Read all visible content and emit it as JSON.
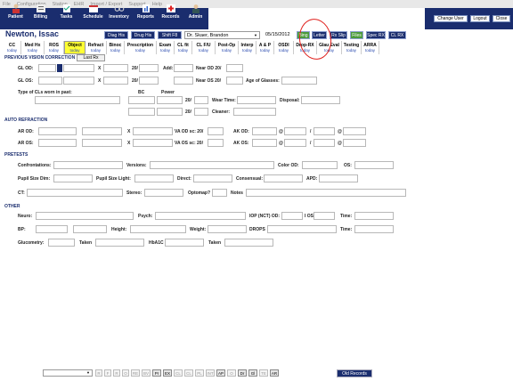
{
  "menu": [
    "File",
    "Configuration",
    "Station",
    "EHR",
    "Import / Export",
    "Support",
    "Help"
  ],
  "toolbar": [
    "Patient",
    "Billing",
    "Tasks",
    "Schedule",
    "Inventory",
    "Reports",
    "Records",
    "Admin"
  ],
  "toolbar_right": [
    "Change User",
    "Logout",
    "Close"
  ],
  "header": {
    "patient_name": "Newton, Issac",
    "buttons": [
      "Diag His",
      "Drug His",
      "Shift F8",
      "Bing",
      "Letter",
      "Rx Slip",
      "Files",
      "Spec RX",
      "CL RX"
    ],
    "doctor": "Dr. Skaer, Brandon",
    "date": "05/15/2012"
  },
  "tabs": [
    {
      "label": "CC",
      "sub": "today"
    },
    {
      "label": "Med Hx",
      "sub": "today"
    },
    {
      "label": "ROS",
      "sub": "today"
    },
    {
      "label": "Object",
      "sub": "today"
    },
    {
      "label": "Refract",
      "sub": "today"
    },
    {
      "label": "Binoc",
      "sub": "today"
    },
    {
      "label": "Prescription",
      "sub": "today"
    },
    {
      "label": "Exam",
      "sub": "today"
    },
    {
      "label": "CL fit",
      "sub": "today"
    },
    {
      "label": "CL F/U",
      "sub": "today"
    },
    {
      "label": "Post-Op",
      "sub": "today"
    },
    {
      "label": "Interp",
      "sub": "today"
    },
    {
      "label": "A & P",
      "sub": "today"
    },
    {
      "label": "OSDI",
      "sub": "today"
    },
    {
      "label": "Drop-RX",
      "sub": "today"
    },
    {
      "label": "Glau Eval",
      "sub": "today"
    },
    {
      "label": "Testing",
      "sub": "today"
    },
    {
      "label": "ARRA",
      "sub": "today"
    }
  ],
  "sections": {
    "prev": "PREVIOUS VISION CORRECTION",
    "auto": "AUTO REFRACTION",
    "pretests": "PRETESTS",
    "other": "OTHER"
  },
  "labels": {
    "last_rx": "Last Rx",
    "gl_od": "GL OD:",
    "gl_os": "GL OS:",
    "x": "X",
    "twenty": "20/",
    "add": "Add:",
    "near_od": "Near OD 20/",
    "near_os": "Near OS 20/",
    "age_glasses": "Age of Glasses:",
    "cl_type": "Type of CLs worn in past:",
    "bc": "BC",
    "power": "Power",
    "wear_time": "Wear Time:",
    "disposal": "Disposal:",
    "cleaner": "Cleaner:",
    "ar_od": "AR OD:",
    "ar_os": "AR OS:",
    "va_od_sc": "VA OD sc: 20/",
    "va_os_sc": "VA OS sc: 20/",
    "ak_od": "AK OD:",
    "ak_os": "AK OS:",
    "at": "@",
    "slash": "/",
    "confrontations": "Confrontations:",
    "versions": "Versions:",
    "color_od": "Color OD:",
    "os": "OS:",
    "pupil_dim": "Pupil Size Dim:",
    "pupil_light": "Pupil Size Light:",
    "direct": "Direct:",
    "consensual": "Consensual:",
    "apd": "APD:",
    "ct": "CT:",
    "stereo": "Stereo:",
    "optomap": "Optomap?",
    "notes": "Notes",
    "neuro": "Neuro:",
    "psych": "Psych:",
    "iop_od": "IOP (NCT) OD:",
    "iop_os": "I OS:",
    "time": "Time:",
    "bp": "BP:",
    "height": "Height:",
    "weight": "Weight:",
    "drops": "DROPS",
    "glucometry": "Glucometry:",
    "taken": "Taken",
    "hba1c": "HbA1C"
  },
  "bottom_buttons": [
    "R",
    "F",
    "R",
    "O",
    "RE",
    "BV",
    "Pr",
    "EX",
    "CL",
    "CL",
    "PL",
    "INT",
    "AP",
    "O",
    "Dr",
    "Gl",
    "TE",
    "AR"
  ],
  "old_records": "Old Records"
}
